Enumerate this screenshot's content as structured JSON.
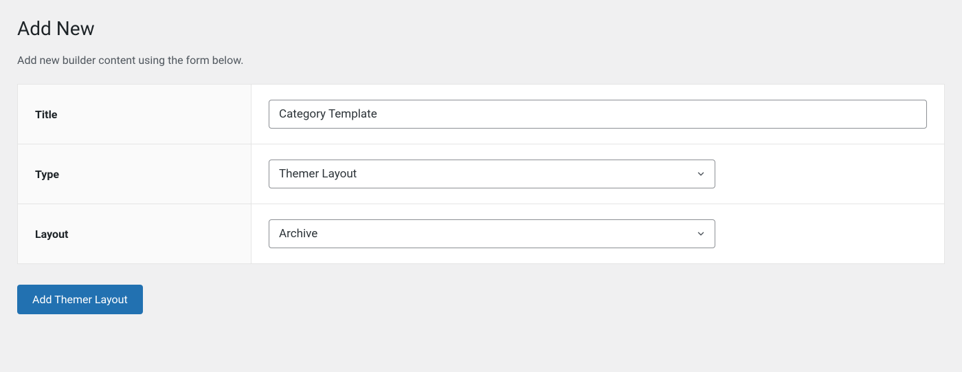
{
  "page": {
    "title": "Add New",
    "description": "Add new builder content using the form below."
  },
  "form": {
    "title": {
      "label": "Title",
      "value": "Category Template"
    },
    "type": {
      "label": "Type",
      "value": "Themer Layout"
    },
    "layout": {
      "label": "Layout",
      "value": "Archive"
    }
  },
  "actions": {
    "submit_label": "Add Themer Layout"
  }
}
